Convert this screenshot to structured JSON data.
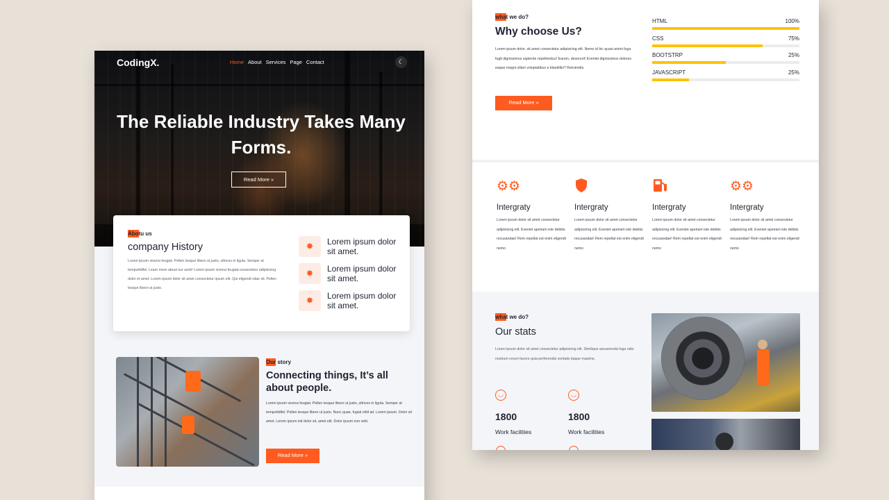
{
  "left": {
    "nav": {
      "logo": "CodingX.",
      "links": [
        "Home",
        "About",
        "Services",
        "Page",
        "Contact"
      ],
      "theme_icon": "moon-icon"
    },
    "hero": {
      "title": "The Reliable Industry Takes Many Forms.",
      "button": "Read More"
    },
    "about": {
      "tag_highlight": "Abo",
      "tag_rest": "tu us",
      "title": "company History",
      "text": "Lorem ipsum viverra feugiat. Pellen tesque libero ut justo, ultrices in ligula. Semper at tempufddfel. Learn more about our work! Lorem ipsum viverra feugiat.consectetur adipisicing dolor et amet. Lorem ipsum dolor sit amet consectetur ipsum elit. Qui eligendi vitae sit. Pellen tesque libero ut justo.",
      "features": [
        {
          "icon": "team-icon",
          "text": "Lorem ipsum dolor sit amet."
        },
        {
          "icon": "team-icon",
          "text": "Lorem ipsum dolor sit amet."
        },
        {
          "icon": "team-icon",
          "text": "Lorem ipsum dolor sit amet."
        }
      ]
    },
    "story": {
      "tag_highlight": "Our",
      "tag_rest": " story",
      "title": "Connecting things, It’s all about people.",
      "text": "Lorem ipsum viverra feugiat. Pellen tesque libero ut justo, ultrices in ligula. Semper at tempufddfel. Pellen tesque libero ut justo. Nunc quae, fugiat nihil ad. Lorem ipsum. Dolor sit amet. Lorem ipsum init dolor sit, amet elit. Dolor ipsum non velit.",
      "button": "Read More"
    }
  },
  "right": {
    "why": {
      "tag_highlight": "wha",
      "tag_rest": "t we do?",
      "title": "Why choose Us?",
      "text": "Lorem ipsum dolor, sit amet consectetur adipisicing elit. Nemo id hic quasi animi fuga fugit dignissimos sapiente repellendus! Earum, deserunt! Eveniet dignissimos dolores eaque magni ullam voluptatibus a blanditiis? Reiciendis.",
      "button": "Read More",
      "skills": [
        {
          "name": "HTML",
          "pct_label": "100%",
          "value": 100
        },
        {
          "name": "CSS",
          "pct_label": "75%",
          "value": 75
        },
        {
          "name": "BOOTSTRP",
          "pct_label": "25%",
          "value": 50
        },
        {
          "name": "JAVASCRIPT",
          "pct_label": "25%",
          "value": 25
        }
      ]
    },
    "services": [
      {
        "icon": "gears-icon",
        "title": "Intergraty",
        "text": "Lorem ipsum dolor sit amet consectetur adipisicing elit. Eveniet aperiam iste debitis recusandae! Rem repellat est enim eligendi nemo"
      },
      {
        "icon": "shield-icon",
        "title": "Intergraty",
        "text": "Lorem ipsum dolor sit amet consectetur adipisicing elit. Eveniet aperiam iste debitis recusandae! Rem repellat est enim eligendi nemo"
      },
      {
        "icon": "gas-pump-icon",
        "title": "Intergraty",
        "text": "Lorem ipsum dolor sit amet consectetur adipisicing elit. Eveniet aperiam iste debitis recusandae! Rem repellat est enim eligendi nemo"
      },
      {
        "icon": "gears-icon",
        "title": "Intergraty",
        "text": "Lorem ipsum dolor sit amet consectetur adipisicing elit. Eveniet aperiam iste debitis recusandae! Rem repellat est enim eligendi nemo"
      }
    ],
    "stats": {
      "tag_highlight": "wha",
      "tag_rest": "t we do?",
      "title": "Our stats",
      "text": "Lorem ipsum dolor sit amet consectetur adipisicing elit. Similique assumenda fuga odio nostrum rerum facere quia perferendis veritatis itaque maxime.",
      "items": [
        {
          "icon": "smile-icon",
          "number": "1800",
          "label": "Work facilities"
        },
        {
          "icon": "smile-icon",
          "number": "1800",
          "label": "Work facilities"
        }
      ]
    }
  },
  "colors": {
    "accent": "#ff5a1f",
    "skill_bar": "#ffc107",
    "background": "#e8e1d8"
  }
}
